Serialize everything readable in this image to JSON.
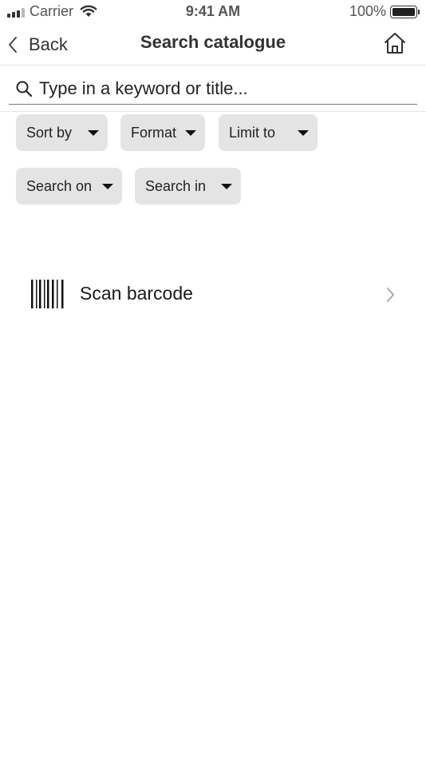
{
  "status_bar": {
    "carrier": "Carrier",
    "time": "9:41 AM",
    "battery": "100%"
  },
  "nav": {
    "back_label": "Back",
    "title": "Search catalogue",
    "home_icon": "home-icon"
  },
  "search": {
    "placeholder": "Type in a keyword or title...",
    "value": ""
  },
  "filters": {
    "sort_by": "Sort by",
    "format": "Format",
    "limit_to": "Limit to",
    "search_on": "Search on",
    "search_in": "Search in"
  },
  "scan": {
    "label": "Scan barcode",
    "icon": "barcode-icon"
  }
}
